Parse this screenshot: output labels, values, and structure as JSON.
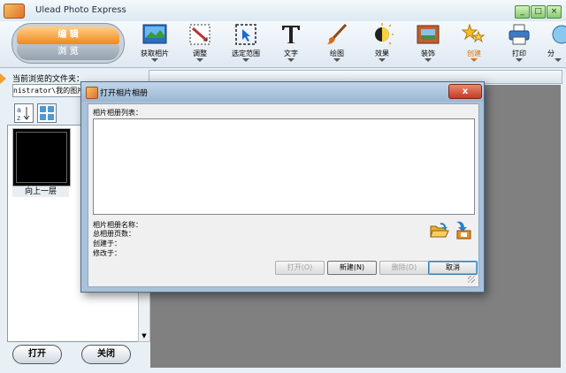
{
  "app": {
    "title": "Ulead Photo Express"
  },
  "mode": {
    "edit": "编 辑",
    "browse": "浏 览"
  },
  "toolbar": [
    {
      "label": "获取相片",
      "icon": "get-photo-icon"
    },
    {
      "label": "调整",
      "icon": "adjust-icon"
    },
    {
      "label": "选定范围",
      "icon": "select-range-icon"
    },
    {
      "label": "文字",
      "icon": "text-icon"
    },
    {
      "label": "绘图",
      "icon": "paint-brush-icon"
    },
    {
      "label": "效果",
      "icon": "effects-icon"
    },
    {
      "label": "装饰",
      "icon": "decorate-icon"
    },
    {
      "label": "创建",
      "icon": "create-icon",
      "active": true
    },
    {
      "label": "打印",
      "icon": "print-icon"
    },
    {
      "label": "分",
      "icon": "share-icon"
    }
  ],
  "left_panel": {
    "current_folder_label": "当前浏览的文件夹：",
    "path": "nistrator\\我的图片",
    "thumbnail_label": "向上一层",
    "open_button": "打开",
    "close_button": "关闭"
  },
  "dialog": {
    "title": "打开相片相册",
    "close": "x",
    "album_list_label": "相片相册列表：",
    "album_name_label": "相片相册名称：",
    "total_pages_label": "总相册页数：",
    "created_label": "创建于：",
    "modified_label": "修改于：",
    "buttons": {
      "open": "打开(O)",
      "new": "新建(N)",
      "delete": "删除(D)",
      "cancel": "取消"
    }
  },
  "colors": {
    "accent_orange": "#f0881e",
    "dialog_frame": "#a9c2d9",
    "close_red": "#c43a24"
  }
}
